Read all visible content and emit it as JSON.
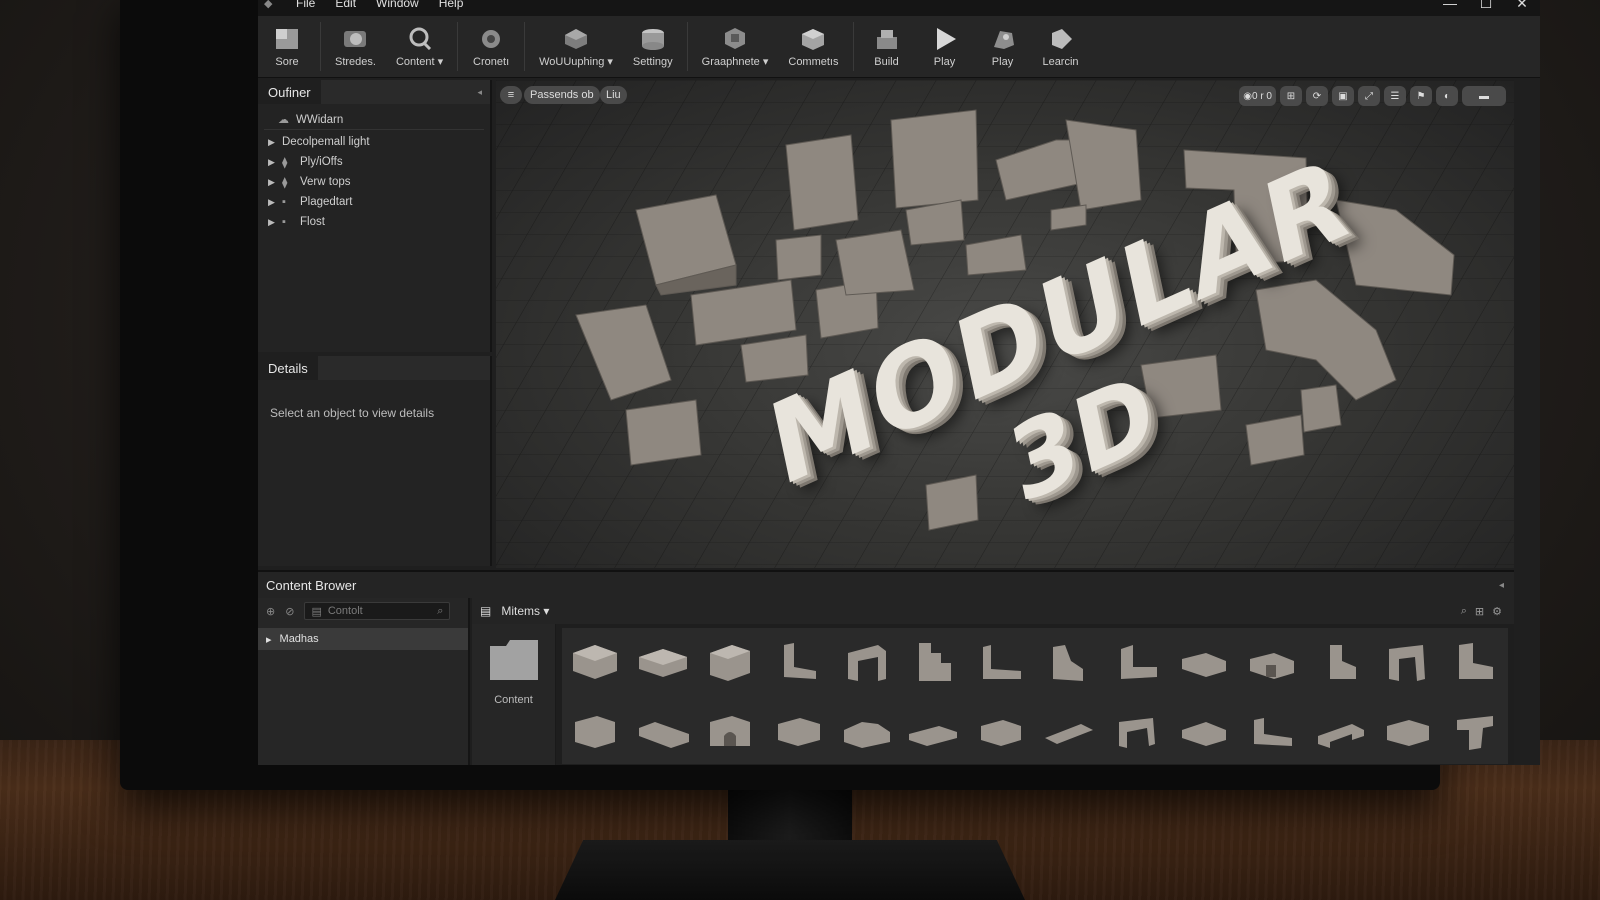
{
  "menu": {
    "items": [
      "File",
      "Edit",
      "Window",
      "Help"
    ],
    "window_controls": [
      "—",
      "☐",
      "✕"
    ]
  },
  "toolbar": {
    "items": [
      {
        "label": "Sore",
        "icon": "save-icon"
      },
      {
        "label": "Stredes.",
        "icon": "source-control-icon"
      },
      {
        "label": "Content",
        "icon": "content-icon",
        "dropdown": true
      },
      {
        "label": "Cronetı",
        "icon": "cinematics-icon"
      },
      {
        "label": "WoUUuphing",
        "icon": "modes-icon",
        "dropdown": true
      },
      {
        "label": "Settingy",
        "icon": "settings-icon"
      },
      {
        "label": "Graaphnete",
        "icon": "blueprint-icon",
        "dropdown": true
      },
      {
        "label": "Commetıs",
        "icon": "compile-icon"
      },
      {
        "label": "Build",
        "icon": "build-icon"
      },
      {
        "label": "Play",
        "icon": "play-icon"
      },
      {
        "label": "Play",
        "icon": "simulate-icon"
      },
      {
        "label": "Learcin",
        "icon": "learn-icon"
      }
    ]
  },
  "outliner": {
    "title": "Oufiner",
    "root": "WWidarn",
    "items": [
      "Decolpemall light",
      "Ply/iOffs",
      "Verw tops",
      "Plagedtart",
      "Flost"
    ]
  },
  "details": {
    "title": "Details",
    "hint": "Select an object to view details"
  },
  "viewport": {
    "left_buttons": [
      "Passends ob",
      "Liu"
    ],
    "right_readout": "0 r 0",
    "title_word": "MODULAR",
    "title_sub": "3D",
    "floor_color": "#3a3a38",
    "block_color": "#8f8880"
  },
  "content_browser": {
    "title": "Content Brower",
    "search_placeholder": "Contolt",
    "folder": "Madhas",
    "crumb": "Mitems",
    "content_folder_label": "Content"
  }
}
